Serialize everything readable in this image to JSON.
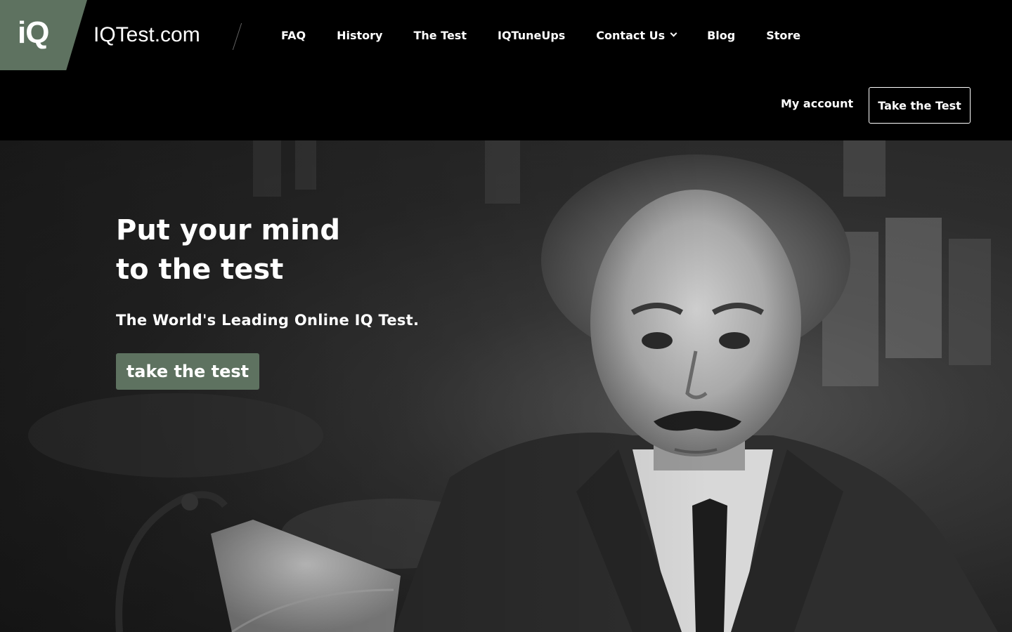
{
  "site": {
    "logo_mark": "iQ",
    "logo_text": "IQTest.com"
  },
  "nav": {
    "items": [
      {
        "label": "FAQ"
      },
      {
        "label": "History"
      },
      {
        "label": "The Test"
      },
      {
        "label": "IQTuneUps"
      },
      {
        "label": "Contact Us",
        "has_dropdown": true
      },
      {
        "label": "Blog"
      },
      {
        "label": "Store"
      }
    ],
    "my_account": "My account",
    "take_test": "Take the Test"
  },
  "hero": {
    "title_line1": "Put your mind",
    "title_line2": "to the test",
    "subtitle": "The World's Leading Online IQ Test.",
    "cta": "take the test"
  },
  "colors": {
    "brand_green": "#5e7260",
    "header_bg": "#000000",
    "text": "#ffffff"
  },
  "icons": {
    "contact_dropdown": "chevron-down-icon"
  }
}
